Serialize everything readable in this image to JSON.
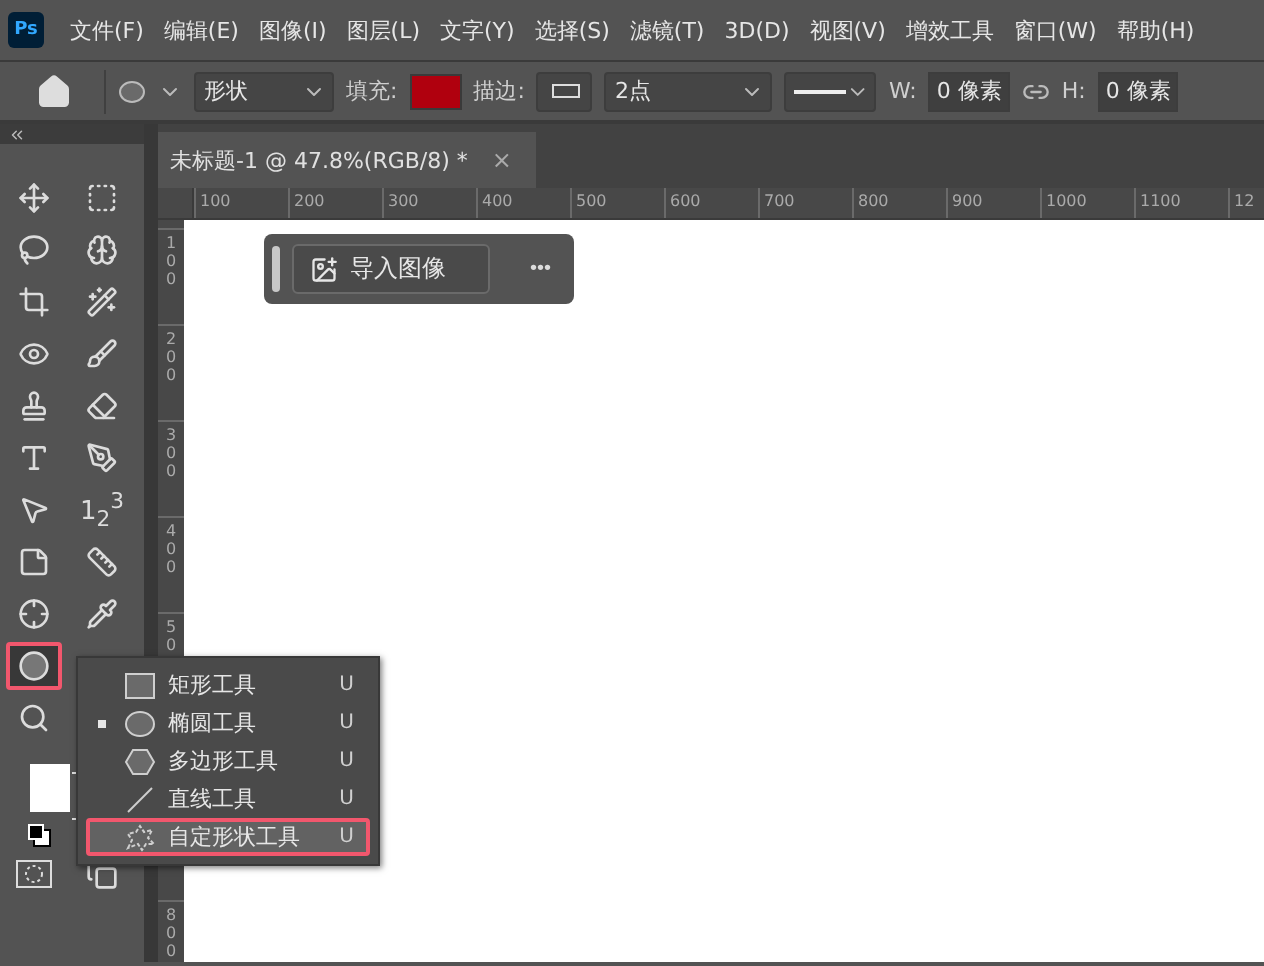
{
  "menu": {
    "logo": "Ps",
    "items": [
      "文件(F)",
      "编辑(E)",
      "图像(I)",
      "图层(L)",
      "文字(Y)",
      "选择(S)",
      "滤镜(T)",
      "3D(D)",
      "视图(V)",
      "增效工具",
      "窗口(W)",
      "帮助(H)"
    ]
  },
  "options": {
    "mode": "形状",
    "fill": {
      "label": "填充:",
      "color": "#b0000e"
    },
    "stroke": {
      "label": "描边:",
      "width": "2点"
    },
    "w": {
      "label": "W:",
      "value": "0 像素"
    },
    "h": {
      "label": "H:",
      "value": "0 像素"
    }
  },
  "tab": {
    "title": "未标题-1 @ 47.8%(RGB/8) *",
    "close": "×"
  },
  "rulers": {
    "horizontal": [
      "100",
      "200",
      "300",
      "400",
      "500",
      "600",
      "700",
      "800",
      "900",
      "1000",
      "1100",
      "12"
    ],
    "vertical": [
      "100",
      "200",
      "300",
      "400",
      "50",
      "800"
    ]
  },
  "float_bar": {
    "button": "导入图像",
    "more": "•••"
  },
  "tool_rows": [
    {
      "tools": [
        {
          "kind": "move",
          "selected": false
        },
        {
          "kind": "marquee",
          "selected": false
        }
      ]
    },
    {
      "tools": [
        {
          "kind": "lasso",
          "selected": false
        },
        {
          "kind": "quick-select",
          "selected": false
        }
      ]
    },
    {
      "tools": [
        {
          "kind": "polygon-lasso",
          "selected": false
        },
        {
          "kind": "wand",
          "selected": false
        }
      ]
    },
    {
      "tools": [
        {
          "kind": "healing",
          "selected": false
        },
        {
          "kind": "brush",
          "selected": false
        }
      ]
    },
    {
      "tools": [
        {
          "kind": "stamp",
          "selected": false
        },
        {
          "kind": "eraser",
          "selected": false
        }
      ]
    },
    {
      "tools": [
        {
          "kind": "type",
          "selected": false
        },
        {
          "kind": "pen",
          "selected": false
        }
      ]
    },
    {
      "tools": [
        {
          "kind": "select",
          "selected": false
        },
        {
          "kind": "count",
          "selected": false,
          "label": "1$_{2}$$^{3}$"
        }
      ]
    },
    {
      "tools": [
        {
          "kind": "note",
          "selected": false
        },
        {
          "kind": "ruler",
          "selected": false
        }
      ]
    },
    {
      "tools": [
        {
          "kind": "sampler",
          "selected": false
        },
        {
          "kind": "eyedropper",
          "selected": false
        }
      ]
    },
    {
      "tools": [
        {
          "kind": "ellipse",
          "selected": true
        }
      ]
    },
    {
      "tools": [
        {
          "kind": "zoom",
          "selected": false
        }
      ]
    }
  ],
  "flyout": [
    {
      "kind": "rect",
      "label": "矩形工具",
      "shortcut": "U",
      "selected": false,
      "highlighted": false
    },
    {
      "kind": "ellipse",
      "label": "椭圆工具",
      "shortcut": "U",
      "selected": true,
      "highlighted": false
    },
    {
      "kind": "polygon",
      "label": "多边形工具",
      "shortcut": "U",
      "selected": false,
      "highlighted": false
    },
    {
      "kind": "line",
      "label": "直线工具",
      "shortcut": "U",
      "selected": false,
      "highlighted": false
    },
    {
      "kind": "custom",
      "label": "自定形状工具",
      "shortcut": "U",
      "selected": false,
      "highlighted": true
    }
  ]
}
